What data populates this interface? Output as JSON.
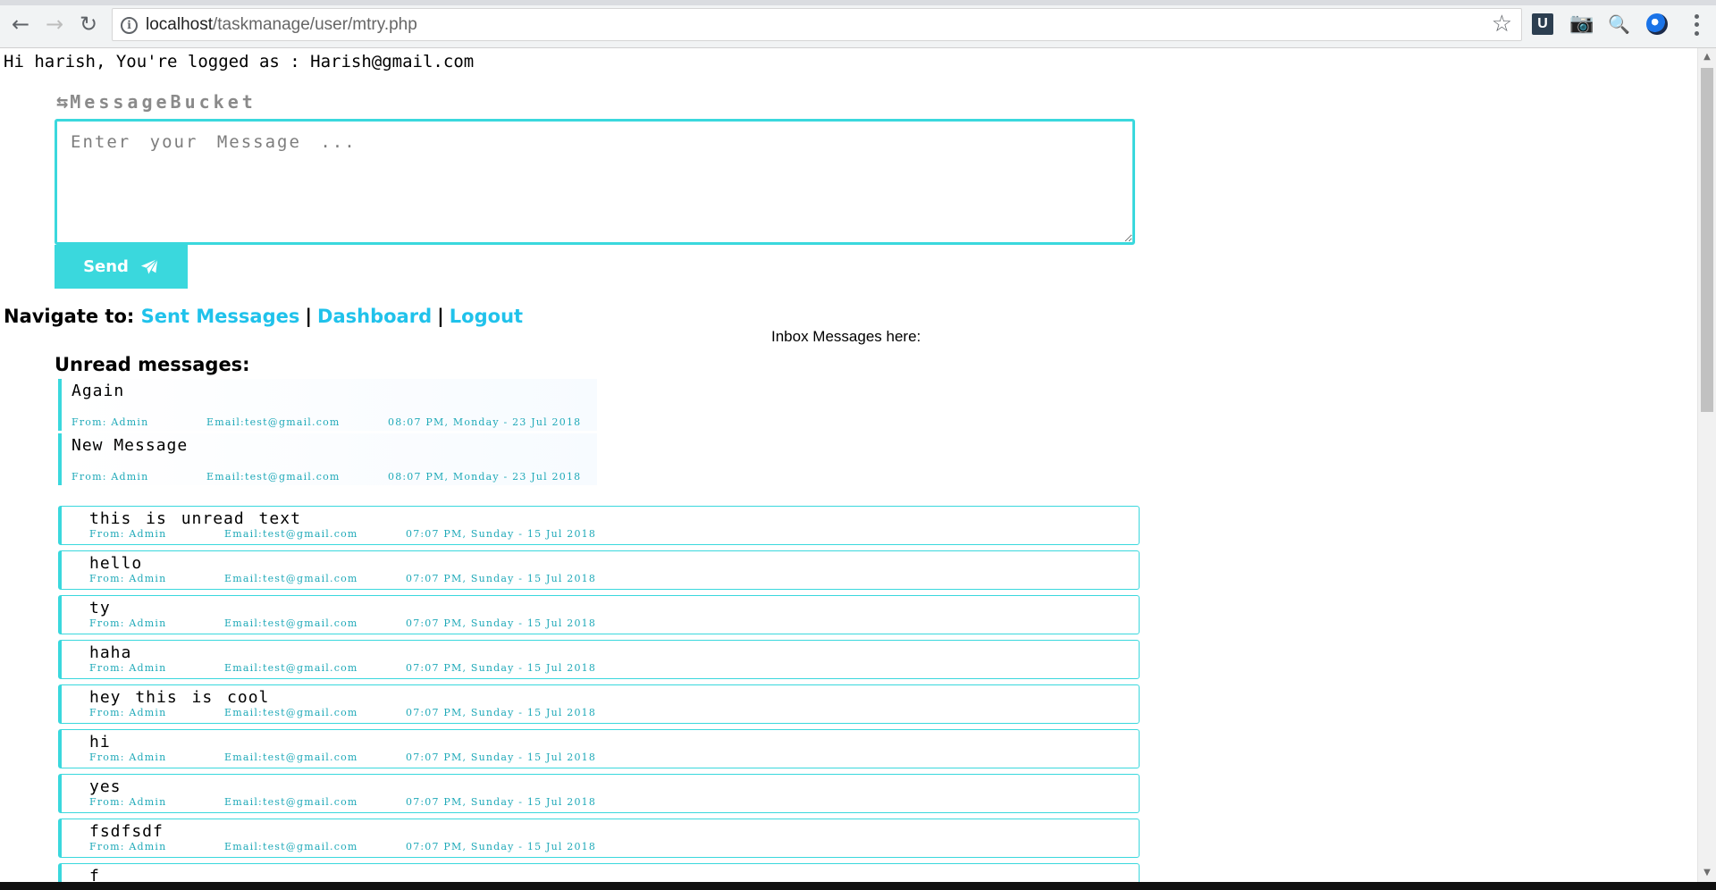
{
  "browser": {
    "url_host": "localhost",
    "url_path": "/taskmanage/user/mtry.php"
  },
  "greeting": "Hi harish, You're logged as : Harish@gmail.com",
  "brand": {
    "name": "MessageBucket",
    "icon": "retweet-icon"
  },
  "composer": {
    "placeholder": "Enter your Message ...",
    "value": "",
    "send_label": "Send",
    "send_icon": "paper-plane-icon",
    "accent_color": "#3ad8dd"
  },
  "nav": {
    "label": "Navigate to:",
    "links": [
      "Sent Messages",
      "Dashboard",
      "Logout"
    ],
    "separator": "|",
    "link_color": "#20c2eb"
  },
  "inbox_heading": "Inbox Messages here:",
  "unread": {
    "heading": "Unread messages:",
    "items": [
      {
        "text": "Again",
        "from": "From: Admin",
        "email": "Email:test@gmail.com",
        "time": "08:07 PM, Monday - 23 Jul 2018"
      },
      {
        "text": "New Message",
        "from": "From: Admin",
        "email": "Email:test@gmail.com",
        "time": "08:07 PM, Monday - 23 Jul 2018"
      }
    ]
  },
  "read": {
    "items": [
      {
        "text": "this is unread text",
        "from": "From: Admin",
        "email": "Email:test@gmail.com",
        "time": "07:07 PM, Sunday - 15 Jul 2018"
      },
      {
        "text": "hello",
        "from": "From: Admin",
        "email": "Email:test@gmail.com",
        "time": "07:07 PM, Sunday - 15 Jul 2018"
      },
      {
        "text": "ty",
        "from": "From: Admin",
        "email": "Email:test@gmail.com",
        "time": "07:07 PM, Sunday - 15 Jul 2018"
      },
      {
        "text": "haha",
        "from": "From: Admin",
        "email": "Email:test@gmail.com",
        "time": "07:07 PM, Sunday - 15 Jul 2018"
      },
      {
        "text": "hey this is cool",
        "from": "From: Admin",
        "email": "Email:test@gmail.com",
        "time": "07:07 PM, Sunday - 15 Jul 2018"
      },
      {
        "text": "hi",
        "from": "From: Admin",
        "email": "Email:test@gmail.com",
        "time": "07:07 PM, Sunday - 15 Jul 2018"
      },
      {
        "text": "yes",
        "from": "From: Admin",
        "email": "Email:test@gmail.com",
        "time": "07:07 PM, Sunday - 15 Jul 2018"
      },
      {
        "text": "fsdfsdf",
        "from": "From: Admin",
        "email": "Email:test@gmail.com",
        "time": "07:07 PM, Sunday - 15 Jul 2018"
      },
      {
        "text": "f",
        "from": "",
        "email": "",
        "time": ""
      }
    ]
  }
}
